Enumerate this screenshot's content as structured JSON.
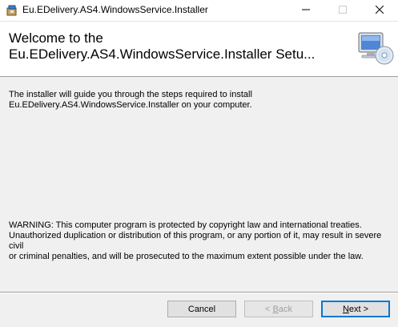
{
  "window": {
    "title": "Eu.EDelivery.AS4.WindowsService.Installer",
    "controls": {
      "minimize": "minimize",
      "maximize": "maximize",
      "close": "close"
    }
  },
  "banner": {
    "title": "Welcome to the\nEu.EDelivery.AS4.WindowsService.Installer Setu..."
  },
  "content": {
    "intro": "The installer will guide you through the steps required to install\nEu.EDelivery.AS4.WindowsService.Installer on your computer.",
    "warning": "WARNING: This computer program is protected by copyright law and international treaties.\nUnauthorized duplication or distribution of this program, or any portion of it, may result in severe civil\nor criminal penalties, and will be prosecuted to the maximum extent possible under the law."
  },
  "buttons": {
    "cancel": "Cancel",
    "back_pre": "< ",
    "back_key": "B",
    "back_post": "ack",
    "next_key": "N",
    "next_post": "ext >"
  },
  "icons": {
    "app": "installer-package-icon",
    "banner": "computer-cd-icon"
  },
  "colors": {
    "accent": "#0078d7",
    "background": "#f0f0f0",
    "banner": "#ffffff"
  }
}
